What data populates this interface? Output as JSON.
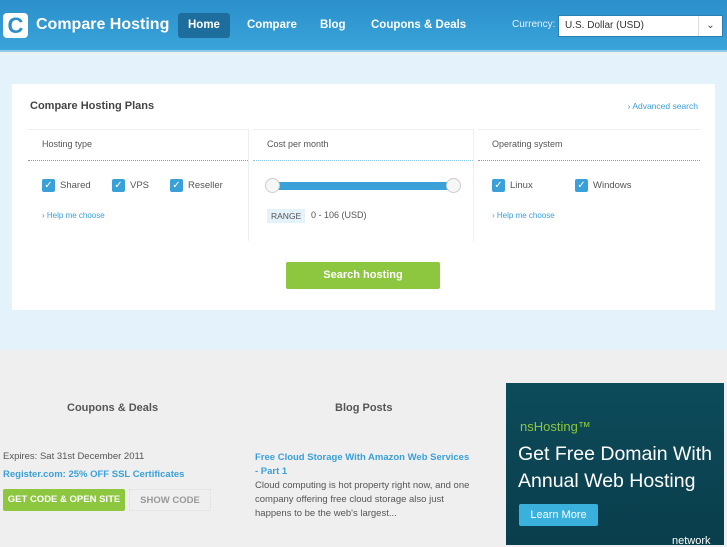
{
  "header": {
    "logo_letter": "C",
    "logo_text": "Compare Hosting",
    "nav": [
      "Home",
      "Compare",
      "Blog",
      "Coupons & Deals"
    ],
    "currency_label": "Currency:",
    "currency_value": "U.S. Dollar (USD)"
  },
  "panel": {
    "title": "Compare Hosting Plans",
    "advanced": "Advanced search",
    "hosting_type": {
      "label": "Hosting type",
      "options": [
        "Shared",
        "VPS",
        "Reseller"
      ],
      "help": "Help me choose"
    },
    "cost": {
      "label": "Cost per month",
      "range_label": "RANGE",
      "range_value": "0 - 106 (USD)",
      "min": 0,
      "max": 106
    },
    "os": {
      "label": "Operating system",
      "options": [
        "Linux",
        "Windows"
      ],
      "help": "Help me choose"
    },
    "search": "Search hosting"
  },
  "coupons": {
    "heading": "Coupons & Deals",
    "expires": "Expires: Sat 31st December 2011",
    "title": "Register.com: 25% OFF SSL Certificates",
    "get_code": "GET CODE & OPEN SITE",
    "show_code": "SHOW CODE"
  },
  "blog": {
    "heading": "Blog Posts",
    "post_title": "Free Cloud Storage With Amazon Web Services - Part 1",
    "excerpt": "Cloud computing is hot property right now, and one company offering free cloud storage also just happens to be the web's largest..."
  },
  "ad": {
    "brand": "nsHosting™",
    "headline": "Get Free Domain With Annual Web Hosting",
    "cta": "Learn More",
    "network": "network"
  }
}
